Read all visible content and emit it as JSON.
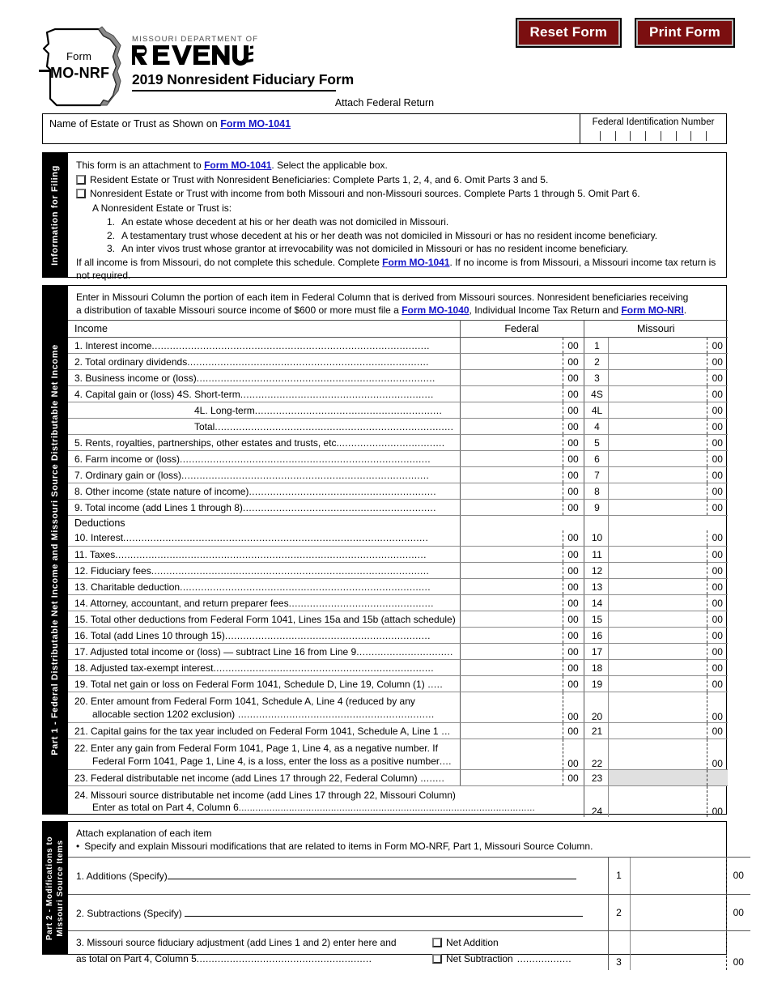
{
  "header": {
    "form_word": "Form",
    "form_id": "MO-NRF",
    "dept_top": "MISSOURI DEPARTMENT OF",
    "dept_wordmark": "REVENUE",
    "title": "2019 Nonresident Fiduciary Form",
    "attach_note": "Attach Federal Return",
    "reset_button": "Reset Form",
    "print_button": "Print Form",
    "accent_color": "#7b0f10",
    "link_color": "#1414c8"
  },
  "namebar": {
    "name_label_pre": "Name of Estate or Trust as Shown on ",
    "name_label_link": "Form MO-1041",
    "fein_label": "Federal Identification Number"
  },
  "info_section": {
    "tab_label": "Information for Filing",
    "intro_pre": "This form is an attachment to ",
    "intro_link": "Form MO-1041",
    "intro_post": ". Select the applicable box.",
    "checkbox1": "Resident Estate or Trust with Nonresident Beneficiaries: Complete Parts 1, 2, 4, and 6. Omit Parts 3 and 5.",
    "checkbox2": "Nonresident Estate or Trust with income from both Missouri and non-Missouri sources.  Complete Parts 1 through 5.  Omit Part 6.",
    "definition_head": "A Nonresident Estate or Trust is:",
    "definitions": [
      {
        "num": "1.",
        "text": "An estate whose decedent at his or her death was not domiciled in Missouri."
      },
      {
        "num": "2.",
        "text": "A testamentary trust whose decedent at his or her death was not domiciled in Missouri or has no resident income beneficiary."
      },
      {
        "num": "3.",
        "text": "An inter vivos trust whose grantor at irrevocability was not domiciled in Missouri or has no resident income beneficiary."
      }
    ],
    "footer_pre": "If all income is from Missouri, do not complete this schedule. Complete ",
    "footer_link": "Form MO-1041",
    "footer_post": ".  If no income is from Missouri, a Missouri income tax return is not required."
  },
  "part1": {
    "tab_label": "Part 1 - Federal Distributable Net Income and Missouri Source Distributable Net Income",
    "intro_a": "Enter in Missouri Column the portion of each item in Federal Column that is derived from Missouri sources.  Nonresident beneficiaries receiving",
    "intro_b_pre": "a distribution of taxable Missouri source income of $600 or more must file a ",
    "intro_link1": "Form MO-1040",
    "intro_b_mid": ", Individual Income Tax Return and ",
    "intro_link2": "Form MO-NRI",
    "intro_b_post": ".",
    "col_income": "Income",
    "col_federal": "Federal",
    "col_missouri": "Missouri",
    "col_deductions": "Deductions",
    "cents": "00",
    "rows": [
      {
        "num": "1",
        "label": "1.  Interest income",
        "dots": "............................................................................................"
      },
      {
        "num": "2",
        "label": "2.  Total ordinary dividends",
        "dots": "................................................................................"
      },
      {
        "num": "3",
        "label": "3.  Business income or (loss)",
        "dots": "..............................................................................."
      },
      {
        "num": "4S",
        "label": "4.  Capital gain or (loss)        4S. Short-term",
        "dots": "................................................................"
      },
      {
        "num": "4L",
        "label": "4L. Long-term",
        "dots": "..............................................................",
        "indent": "sub"
      },
      {
        "num": "4",
        "label": "Total",
        "dots": "...............................................................................",
        "indent": "sub"
      },
      {
        "num": "5",
        "label": "5.  Rents, royalties, partnerships, other estates and trusts, etc.",
        "dots": "..................................."
      },
      {
        "num": "6",
        "label": "6.  Farm income or (loss)",
        "dots": "..................................................................................."
      },
      {
        "num": "7",
        "label": "7.  Ordinary gain or (loss)",
        "dots": ".................................................................................."
      },
      {
        "num": "8",
        "label": "8.  Other income (state nature of income)",
        "dots": ".............................................................."
      },
      {
        "num": "9",
        "label": "9.  Total income (add Lines 1 through 8)",
        "dots": "................................................................"
      },
      {
        "num": "10",
        "label": "10. Interest",
        "dots": "....................................................................................................."
      },
      {
        "num": "11",
        "label": "11. Taxes",
        "dots": "......................................................................................................."
      },
      {
        "num": "12",
        "label": "12. Fiduciary fees",
        "dots": "............................................................................................"
      },
      {
        "num": "13",
        "label": "13. Charitable deduction",
        "dots": "..................................................................................."
      },
      {
        "num": "14",
        "label": "14. Attorney, accountant, and return preparer fees",
        "dots": "................................................"
      },
      {
        "num": "15",
        "label": "15. Total other deductions from Federal Form 1041, Lines 15a and 15b (attach schedule)",
        "dots": ""
      },
      {
        "num": "16",
        "label": "16. Total (add Lines 10 through 15)",
        "dots": "...................................................................."
      },
      {
        "num": "17",
        "label": "17. Adjusted total income or (loss) — subtract Line 16 from Line 9",
        "dots": "................................"
      },
      {
        "num": "18",
        "label": "18. Adjusted tax-exempt interest",
        "dots": "........................................................................."
      },
      {
        "num": "19",
        "label": "19. Total net gain or loss on Federal Form 1041, Schedule D, Line 19, Column (1)",
        "dots": " ....."
      },
      {
        "num": "20",
        "label": "20. Enter amount from Federal Form 1041, Schedule A, Line 4 (reduced by any",
        "label2": "allocable section 1202 exclusion)",
        "dots2": " .................................................................",
        "tall": true
      },
      {
        "num": "21",
        "label": "21. Capital gains for the tax year included on Federal Form 1041, Schedule A, Line 1",
        "dots": " ..."
      },
      {
        "num": "22",
        "label": "22. Enter any gain from Federal Form 1041, Page 1, Line 4, as a negative number. If",
        "label2": "Federal Form 1041, Page 1, Line 4, is a loss, enter the loss as a positive number",
        "dots2": "....",
        "tall": true
      },
      {
        "num": "23",
        "label": "23. Federal distributable net income (add Lines 17 through 22, Federal Column)",
        "dots": " ........",
        "mo_shaded": true
      },
      {
        "num": "24",
        "label": "24. Missouri source distributable net income (add Lines 17 through 22, Missouri Column)",
        "label2": "Enter as total on Part 4, Column 6",
        "dots2": "..........................................................................................................",
        "wide": true
      }
    ]
  },
  "part2": {
    "tab_line1": "Part 2 - Modifications to",
    "tab_line2": "Missouri Source Items",
    "header1": "Attach explanation of each item",
    "bullet": "•",
    "header2": "Specify and explain Missouri modifications that are related to items in Form MO-NRF, Part 1, Missouri Source Column.",
    "cents": "00",
    "row1_label": "1. Additions (Specify)",
    "row1_num": "1",
    "row2_label": "2. Subtractions (Specify) ",
    "row2_num": "2",
    "row3_label": "3. Missouri source fiduciary adjustment (add Lines 1 and 2) enter here and",
    "row3_label2": "as total on Part 4, Column 5",
    "row3_dots": "..........................................................",
    "row3_dots2": "..................",
    "net_addition": "Net Addition",
    "net_subtraction": "Net Subtraction",
    "row3_num": "3"
  }
}
